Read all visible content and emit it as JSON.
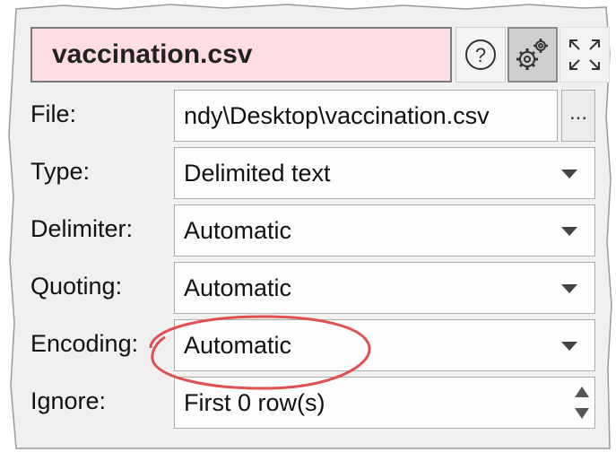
{
  "header": {
    "title": "vaccination.csv",
    "help_icon": "help-circle-icon",
    "settings_icon": "gears-icon",
    "expand_icon": "expand-arrows-icon"
  },
  "fields": {
    "file": {
      "label": "File:",
      "value": "ndy\\Desktop\\vaccination.csv",
      "browse_label": "..."
    },
    "type": {
      "label": "Type:",
      "value": "Delimited text"
    },
    "delimiter": {
      "label": "Delimiter:",
      "value": "Automatic"
    },
    "quoting": {
      "label": "Quoting:",
      "value": "Automatic"
    },
    "encoding": {
      "label": "Encoding:",
      "value": "Automatic"
    },
    "ignore": {
      "label": "Ignore:",
      "value": "First 0 row(s)"
    }
  },
  "colors": {
    "title_background": "#ffdde4",
    "annotation_circle": "#e05050"
  }
}
